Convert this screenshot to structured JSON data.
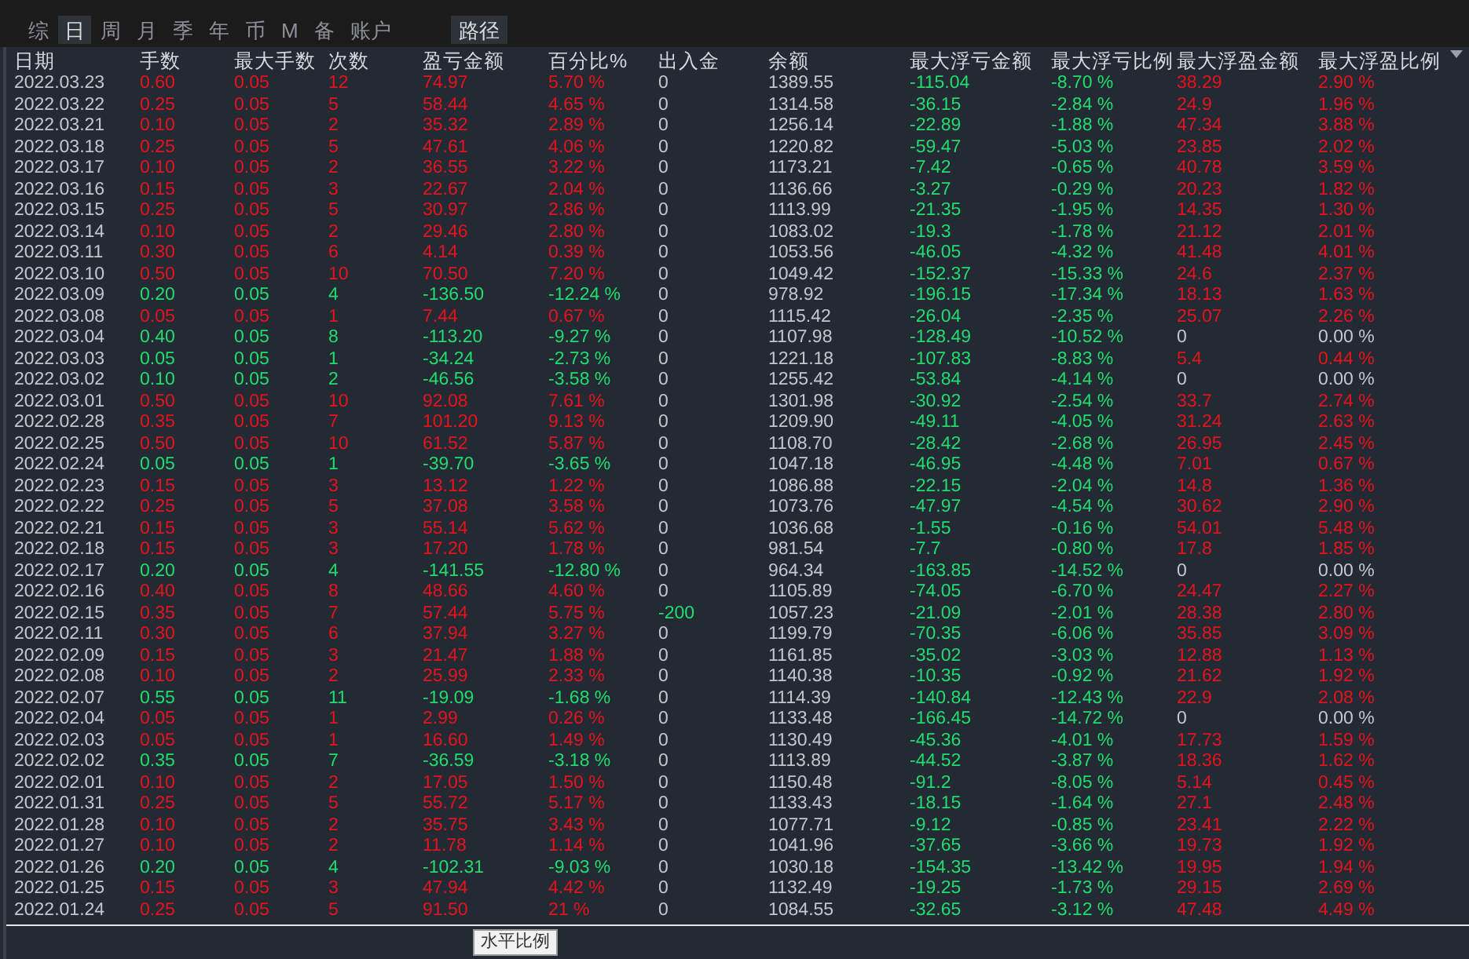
{
  "tabs": [
    {
      "label": "综",
      "selected": false
    },
    {
      "label": "日",
      "selected": true
    },
    {
      "label": "周",
      "selected": false
    },
    {
      "label": "月",
      "selected": false
    },
    {
      "label": "季",
      "selected": false
    },
    {
      "label": "年",
      "selected": false
    },
    {
      "label": "币",
      "selected": false
    },
    {
      "label": "M",
      "selected": false
    },
    {
      "label": "备",
      "selected": false
    },
    {
      "label": "账户",
      "selected": false
    }
  ],
  "path_button": "路径",
  "columns": [
    {
      "label": "日期",
      "kind": "plain"
    },
    {
      "label": "手数",
      "kind": "row"
    },
    {
      "label": "最大手数",
      "kind": "row"
    },
    {
      "label": "次数",
      "kind": "row"
    },
    {
      "label": "盈亏金额",
      "kind": "row"
    },
    {
      "label": "百分比%",
      "kind": "row"
    },
    {
      "label": "出入金",
      "kind": "transfer"
    },
    {
      "label": "余额",
      "kind": "plain"
    },
    {
      "label": "最大浮亏金额",
      "kind": "loss"
    },
    {
      "label": "最大浮亏比例",
      "kind": "loss"
    },
    {
      "label": "最大浮盈金额",
      "kind": "float"
    },
    {
      "label": "最大浮盈比例",
      "kind": "float"
    }
  ],
  "rows": [
    {
      "kind": "gain",
      "float_gain": true,
      "transfer_out": false,
      "cells": [
        "2022.03.23",
        "0.60",
        "0.05",
        "12",
        "74.97",
        "5.70 %",
        "0",
        "1389.55",
        "-115.04",
        "-8.70 %",
        "38.29",
        "2.90 %"
      ]
    },
    {
      "kind": "gain",
      "float_gain": true,
      "transfer_out": false,
      "cells": [
        "2022.03.22",
        "0.25",
        "0.05",
        "5",
        "58.44",
        "4.65 %",
        "0",
        "1314.58",
        "-36.15",
        "-2.84 %",
        "24.9",
        "1.96 %"
      ]
    },
    {
      "kind": "gain",
      "float_gain": true,
      "transfer_out": false,
      "cells": [
        "2022.03.21",
        "0.10",
        "0.05",
        "2",
        "35.32",
        "2.89 %",
        "0",
        "1256.14",
        "-22.89",
        "-1.88 %",
        "47.34",
        "3.88 %"
      ]
    },
    {
      "kind": "gain",
      "float_gain": true,
      "transfer_out": false,
      "cells": [
        "2022.03.18",
        "0.25",
        "0.05",
        "5",
        "47.61",
        "4.06 %",
        "0",
        "1220.82",
        "-59.47",
        "-5.03 %",
        "23.85",
        "2.02 %"
      ]
    },
    {
      "kind": "gain",
      "float_gain": true,
      "transfer_out": false,
      "cells": [
        "2022.03.17",
        "0.10",
        "0.05",
        "2",
        "36.55",
        "3.22 %",
        "0",
        "1173.21",
        "-7.42",
        "-0.65 %",
        "40.78",
        "3.59 %"
      ]
    },
    {
      "kind": "gain",
      "float_gain": true,
      "transfer_out": false,
      "cells": [
        "2022.03.16",
        "0.15",
        "0.05",
        "3",
        "22.67",
        "2.04 %",
        "0",
        "1136.66",
        "-3.27",
        "-0.29 %",
        "20.23",
        "1.82 %"
      ]
    },
    {
      "kind": "gain",
      "float_gain": true,
      "transfer_out": false,
      "cells": [
        "2022.03.15",
        "0.25",
        "0.05",
        "5",
        "30.97",
        "2.86 %",
        "0",
        "1113.99",
        "-21.35",
        "-1.95 %",
        "14.35",
        "1.30 %"
      ]
    },
    {
      "kind": "gain",
      "float_gain": true,
      "transfer_out": false,
      "cells": [
        "2022.03.14",
        "0.10",
        "0.05",
        "2",
        "29.46",
        "2.80 %",
        "0",
        "1083.02",
        "-19.3",
        "-1.78 %",
        "21.12",
        "2.01 %"
      ]
    },
    {
      "kind": "gain",
      "float_gain": true,
      "transfer_out": false,
      "cells": [
        "2022.03.11",
        "0.30",
        "0.05",
        "6",
        "4.14",
        "0.39 %",
        "0",
        "1053.56",
        "-46.05",
        "-4.32 %",
        "41.48",
        "4.01 %"
      ]
    },
    {
      "kind": "gain",
      "float_gain": true,
      "transfer_out": false,
      "cells": [
        "2022.03.10",
        "0.50",
        "0.05",
        "10",
        "70.50",
        "7.20 %",
        "0",
        "1049.42",
        "-152.37",
        "-15.33 %",
        "24.6",
        "2.37 %"
      ]
    },
    {
      "kind": "loss",
      "float_gain": true,
      "transfer_out": false,
      "cells": [
        "2022.03.09",
        "0.20",
        "0.05",
        "4",
        "-136.50",
        "-12.24 %",
        "0",
        "978.92",
        "-196.15",
        "-17.34 %",
        "18.13",
        "1.63 %"
      ]
    },
    {
      "kind": "gain",
      "float_gain": true,
      "transfer_out": false,
      "cells": [
        "2022.03.08",
        "0.05",
        "0.05",
        "1",
        "7.44",
        "0.67 %",
        "0",
        "1115.42",
        "-26.04",
        "-2.35 %",
        "25.07",
        "2.26 %"
      ]
    },
    {
      "kind": "loss",
      "float_gain": false,
      "transfer_out": false,
      "cells": [
        "2022.03.04",
        "0.40",
        "0.05",
        "8",
        "-113.20",
        "-9.27 %",
        "0",
        "1107.98",
        "-128.49",
        "-10.52 %",
        "0",
        "0.00 %"
      ]
    },
    {
      "kind": "loss",
      "float_gain": true,
      "transfer_out": false,
      "cells": [
        "2022.03.03",
        "0.05",
        "0.05",
        "1",
        "-34.24",
        "-2.73 %",
        "0",
        "1221.18",
        "-107.83",
        "-8.83 %",
        "5.4",
        "0.44 %"
      ]
    },
    {
      "kind": "loss",
      "float_gain": false,
      "transfer_out": false,
      "cells": [
        "2022.03.02",
        "0.10",
        "0.05",
        "2",
        "-46.56",
        "-3.58 %",
        "0",
        "1255.42",
        "-53.84",
        "-4.14 %",
        "0",
        "0.00 %"
      ]
    },
    {
      "kind": "gain",
      "float_gain": true,
      "transfer_out": false,
      "cells": [
        "2022.03.01",
        "0.50",
        "0.05",
        "10",
        "92.08",
        "7.61 %",
        "0",
        "1301.98",
        "-30.92",
        "-2.54 %",
        "33.7",
        "2.74 %"
      ]
    },
    {
      "kind": "gain",
      "float_gain": true,
      "transfer_out": false,
      "cells": [
        "2022.02.28",
        "0.35",
        "0.05",
        "7",
        "101.20",
        "9.13 %",
        "0",
        "1209.90",
        "-49.11",
        "-4.05 %",
        "31.24",
        "2.63 %"
      ]
    },
    {
      "kind": "gain",
      "float_gain": true,
      "transfer_out": false,
      "cells": [
        "2022.02.25",
        "0.50",
        "0.05",
        "10",
        "61.52",
        "5.87 %",
        "0",
        "1108.70",
        "-28.42",
        "-2.68 %",
        "26.95",
        "2.45 %"
      ]
    },
    {
      "kind": "loss",
      "float_gain": true,
      "transfer_out": false,
      "cells": [
        "2022.02.24",
        "0.05",
        "0.05",
        "1",
        "-39.70",
        "-3.65 %",
        "0",
        "1047.18",
        "-46.95",
        "-4.48 %",
        "7.01",
        "0.67 %"
      ]
    },
    {
      "kind": "gain",
      "float_gain": true,
      "transfer_out": false,
      "cells": [
        "2022.02.23",
        "0.15",
        "0.05",
        "3",
        "13.12",
        "1.22 %",
        "0",
        "1086.88",
        "-22.15",
        "-2.04 %",
        "14.8",
        "1.36 %"
      ]
    },
    {
      "kind": "gain",
      "float_gain": true,
      "transfer_out": false,
      "cells": [
        "2022.02.22",
        "0.25",
        "0.05",
        "5",
        "37.08",
        "3.58 %",
        "0",
        "1073.76",
        "-47.97",
        "-4.54 %",
        "30.62",
        "2.90 %"
      ]
    },
    {
      "kind": "gain",
      "float_gain": true,
      "transfer_out": false,
      "cells": [
        "2022.02.21",
        "0.15",
        "0.05",
        "3",
        "55.14",
        "5.62 %",
        "0",
        "1036.68",
        "-1.55",
        "-0.16 %",
        "54.01",
        "5.48 %"
      ]
    },
    {
      "kind": "gain",
      "float_gain": true,
      "transfer_out": false,
      "cells": [
        "2022.02.18",
        "0.15",
        "0.05",
        "3",
        "17.20",
        "1.78 %",
        "0",
        "981.54",
        "-7.7",
        "-0.80 %",
        "17.8",
        "1.85 %"
      ]
    },
    {
      "kind": "loss",
      "float_gain": false,
      "transfer_out": false,
      "cells": [
        "2022.02.17",
        "0.20",
        "0.05",
        "4",
        "-141.55",
        "-12.80 %",
        "0",
        "964.34",
        "-163.85",
        "-14.52 %",
        "0",
        "0.00 %"
      ]
    },
    {
      "kind": "gain",
      "float_gain": true,
      "transfer_out": false,
      "cells": [
        "2022.02.16",
        "0.40",
        "0.05",
        "8",
        "48.66",
        "4.60 %",
        "0",
        "1105.89",
        "-74.05",
        "-6.70 %",
        "24.47",
        "2.27 %"
      ]
    },
    {
      "kind": "gain",
      "float_gain": true,
      "transfer_out": true,
      "cells": [
        "2022.02.15",
        "0.35",
        "0.05",
        "7",
        "57.44",
        "5.75 %",
        "-200",
        "1057.23",
        "-21.09",
        "-2.01 %",
        "28.38",
        "2.80 %"
      ]
    },
    {
      "kind": "gain",
      "float_gain": true,
      "transfer_out": false,
      "cells": [
        "2022.02.11",
        "0.30",
        "0.05",
        "6",
        "37.94",
        "3.27 %",
        "0",
        "1199.79",
        "-70.35",
        "-6.06 %",
        "35.85",
        "3.09 %"
      ]
    },
    {
      "kind": "gain",
      "float_gain": true,
      "transfer_out": false,
      "cells": [
        "2022.02.09",
        "0.15",
        "0.05",
        "3",
        "21.47",
        "1.88 %",
        "0",
        "1161.85",
        "-35.02",
        "-3.03 %",
        "12.88",
        "1.13 %"
      ]
    },
    {
      "kind": "gain",
      "float_gain": true,
      "transfer_out": false,
      "cells": [
        "2022.02.08",
        "0.10",
        "0.05",
        "2",
        "25.99",
        "2.33 %",
        "0",
        "1140.38",
        "-10.35",
        "-0.92 %",
        "21.62",
        "1.92 %"
      ]
    },
    {
      "kind": "loss",
      "float_gain": true,
      "transfer_out": false,
      "cells": [
        "2022.02.07",
        "0.55",
        "0.05",
        "11",
        "-19.09",
        "-1.68 %",
        "0",
        "1114.39",
        "-140.84",
        "-12.43 %",
        "22.9",
        "2.08 %"
      ]
    },
    {
      "kind": "gain",
      "float_gain": false,
      "transfer_out": false,
      "cells": [
        "2022.02.04",
        "0.05",
        "0.05",
        "1",
        "2.99",
        "0.26 %",
        "0",
        "1133.48",
        "-166.45",
        "-14.72 %",
        "0",
        "0.00 %"
      ]
    },
    {
      "kind": "gain",
      "float_gain": true,
      "transfer_out": false,
      "cells": [
        "2022.02.03",
        "0.05",
        "0.05",
        "1",
        "16.60",
        "1.49 %",
        "0",
        "1130.49",
        "-45.36",
        "-4.01 %",
        "17.73",
        "1.59 %"
      ]
    },
    {
      "kind": "loss",
      "float_gain": true,
      "transfer_out": false,
      "cells": [
        "2022.02.02",
        "0.35",
        "0.05",
        "7",
        "-36.59",
        "-3.18 %",
        "0",
        "1113.89",
        "-44.52",
        "-3.87 %",
        "18.36",
        "1.62 %"
      ]
    },
    {
      "kind": "gain",
      "float_gain": true,
      "transfer_out": false,
      "cells": [
        "2022.02.01",
        "0.10",
        "0.05",
        "2",
        "17.05",
        "1.50 %",
        "0",
        "1150.48",
        "-91.2",
        "-8.05 %",
        "5.14",
        "0.45 %"
      ]
    },
    {
      "kind": "gain",
      "float_gain": true,
      "transfer_out": false,
      "cells": [
        "2022.01.31",
        "0.25",
        "0.05",
        "5",
        "55.72",
        "5.17 %",
        "0",
        "1133.43",
        "-18.15",
        "-1.64 %",
        "27.1",
        "2.48 %"
      ]
    },
    {
      "kind": "gain",
      "float_gain": true,
      "transfer_out": false,
      "cells": [
        "2022.01.28",
        "0.10",
        "0.05",
        "2",
        "35.75",
        "3.43 %",
        "0",
        "1077.71",
        "-9.12",
        "-0.85 %",
        "23.41",
        "2.22 %"
      ]
    },
    {
      "kind": "gain",
      "float_gain": true,
      "transfer_out": false,
      "cells": [
        "2022.01.27",
        "0.10",
        "0.05",
        "2",
        "11.78",
        "1.14 %",
        "0",
        "1041.96",
        "-37.65",
        "-3.66 %",
        "19.73",
        "1.92 %"
      ]
    },
    {
      "kind": "loss",
      "float_gain": true,
      "transfer_out": false,
      "cells": [
        "2022.01.26",
        "0.20",
        "0.05",
        "4",
        "-102.31",
        "-9.03 %",
        "0",
        "1030.18",
        "-154.35",
        "-13.42 %",
        "19.95",
        "1.94 %"
      ]
    },
    {
      "kind": "gain",
      "float_gain": true,
      "transfer_out": false,
      "cells": [
        "2022.01.25",
        "0.15",
        "0.05",
        "3",
        "47.94",
        "4.42 %",
        "0",
        "1132.49",
        "-19.25",
        "-1.73 %",
        "29.15",
        "2.69 %"
      ]
    },
    {
      "kind": "gain",
      "float_gain": true,
      "transfer_out": false,
      "cells": [
        "2022.01.24",
        "0.25",
        "0.05",
        "5",
        "91.50",
        "21 %",
        "0",
        "1084.55",
        "-32.65",
        "-3.12 %",
        "47.48",
        "4.49 %"
      ]
    }
  ],
  "tooltip": "水平比例"
}
